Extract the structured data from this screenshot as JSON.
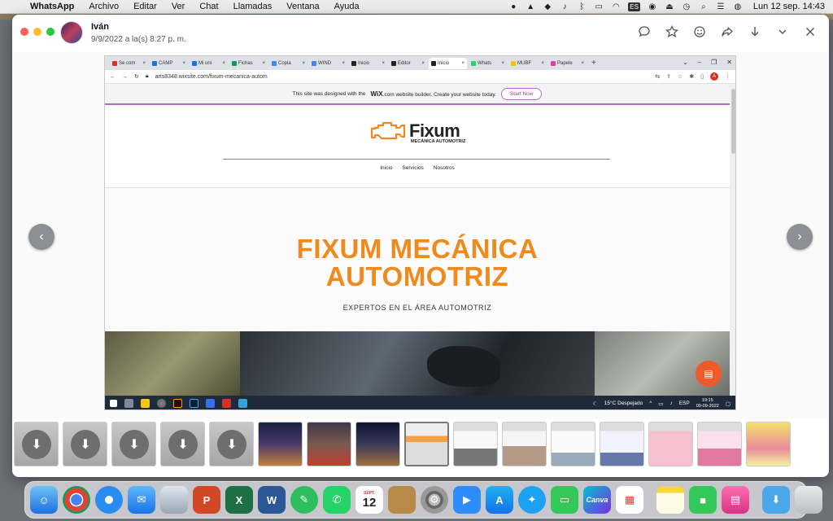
{
  "menubar": {
    "app": "WhatsApp",
    "items": [
      "Archivo",
      "Editar",
      "Ver",
      "Chat",
      "Llamadas",
      "Ventana",
      "Ayuda"
    ],
    "keyboard_badge": "ES",
    "clock": "Lun 12 sep.  14:43"
  },
  "viewer": {
    "contact_name": "Iván",
    "date": "9/9/2022 a la(s) 8:27 p. m."
  },
  "browser": {
    "tabs": [
      "Se com",
      "CAMP",
      "Mi uni",
      "Fichas",
      "Copia",
      "WIND",
      "Inicio",
      "Editor",
      "Inicio",
      "Whats",
      "MUBF",
      "Papele"
    ],
    "url": "arts8348.wixsite.com/fixum-mecanica-autom",
    "profile_letter": "A"
  },
  "site": {
    "wix_banner_pre": "This site was designed with the",
    "wix_brand": "WiX",
    "wix_banner_post": ".com website builder. Create your website today.",
    "start_now": "Start Now",
    "logo_word": "Fixum",
    "logo_sub": "MECÁNICA AUTOMOTRIZ",
    "nav": [
      "Inicio",
      "Servicios",
      "Nosotros"
    ],
    "hero_line1": "FIXUM MECÁNICA",
    "hero_line2": "AUTOMOTRIZ",
    "hero_sub": "EXPERTOS EN EL ÁREA AUTOMOTRIZ"
  },
  "taskbar": {
    "weather": "15°C  Despejado",
    "lang": "ESP",
    "time": "19:15",
    "date": "09-09-2022"
  },
  "dock": {
    "calendar_month": "SEPT.",
    "calendar_day": "12"
  }
}
